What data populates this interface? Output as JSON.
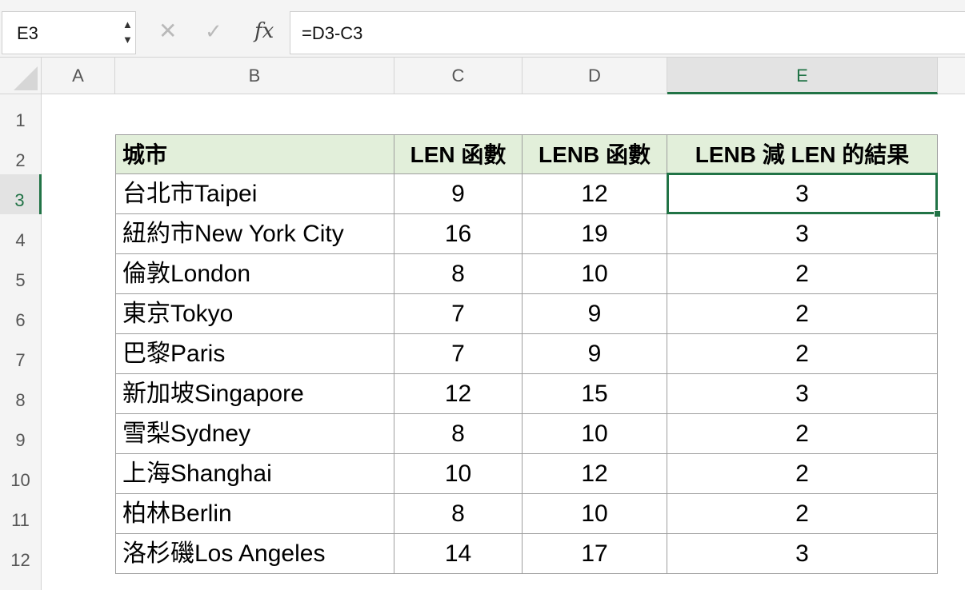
{
  "formula_bar": {
    "name_box": "E3",
    "name_up": "▲",
    "name_down": "▼",
    "cancel_glyph": "✕",
    "enter_glyph": "✓",
    "fx_label": "fx",
    "formula": "=D3-C3"
  },
  "columns": [
    "A",
    "B",
    "C",
    "D",
    "E"
  ],
  "rows": [
    "1",
    "2",
    "3",
    "4",
    "5",
    "6",
    "7",
    "8",
    "9",
    "10",
    "11",
    "12"
  ],
  "active_cell": {
    "column": "E",
    "row": "3"
  },
  "table": {
    "headers": [
      "城市",
      "LEN 函數",
      "LENB 函數",
      "LENB 減 LEN 的結果"
    ],
    "rows": [
      [
        "台北市Taipei",
        "9",
        "12",
        "3"
      ],
      [
        "紐約市New York City",
        "16",
        "19",
        "3"
      ],
      [
        "倫敦London",
        "8",
        "10",
        "2"
      ],
      [
        "東京Tokyo",
        "7",
        "9",
        "2"
      ],
      [
        "巴黎Paris",
        "7",
        "9",
        "2"
      ],
      [
        "新加坡Singapore",
        "12",
        "15",
        "3"
      ],
      [
        "雪梨Sydney",
        "8",
        "10",
        "2"
      ],
      [
        "上海Shanghai",
        "10",
        "12",
        "2"
      ],
      [
        "柏林Berlin",
        "8",
        "10",
        "2"
      ],
      [
        "洛杉磯Los Angeles",
        "14",
        "17",
        "3"
      ]
    ]
  },
  "colors": {
    "header_fill": "#e2efda",
    "accent": "#217346",
    "grid_border": "#9e9e9e"
  }
}
